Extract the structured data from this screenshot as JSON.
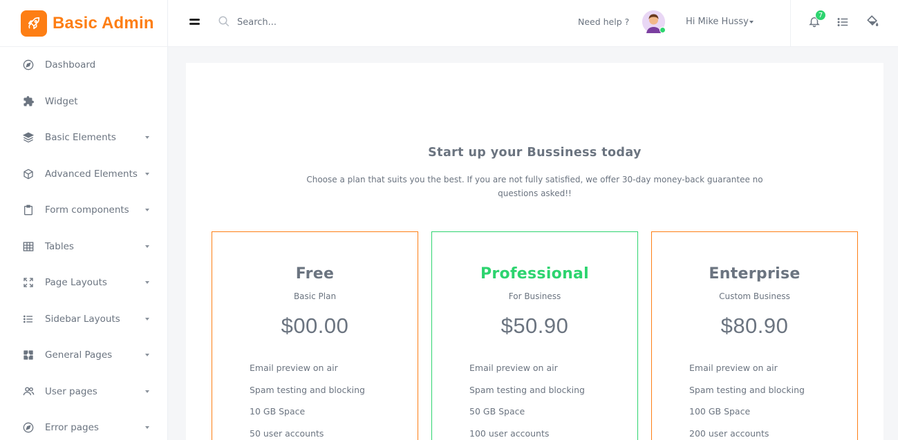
{
  "brand": {
    "name": "Basic Admin",
    "color": "#fd7e14"
  },
  "sidebar": {
    "items": [
      {
        "label": "Dashboard",
        "icon": "compass-icon",
        "has_submenu": false
      },
      {
        "label": "Widget",
        "icon": "puzzle-icon",
        "has_submenu": false
      },
      {
        "label": "Basic Elements",
        "icon": "layers-icon",
        "has_submenu": true
      },
      {
        "label": "Advanced Elements",
        "icon": "box-icon",
        "has_submenu": true
      },
      {
        "label": "Form components",
        "icon": "clipboard-icon",
        "has_submenu": true
      },
      {
        "label": "Tables",
        "icon": "table-icon",
        "has_submenu": true
      },
      {
        "label": "Page Layouts",
        "icon": "expand-icon",
        "has_submenu": true
      },
      {
        "label": "Sidebar Layouts",
        "icon": "list-icon",
        "has_submenu": true
      },
      {
        "label": "General Pages",
        "icon": "grid-icon",
        "has_submenu": true
      },
      {
        "label": "User pages",
        "icon": "users-icon",
        "has_submenu": true
      },
      {
        "label": "Error pages",
        "icon": "compass-icon",
        "has_submenu": true
      }
    ]
  },
  "header": {
    "search_placeholder": "Search...",
    "help_label": "Need help ?",
    "user_greeting": "Hi Mike Hussy",
    "notification_count": "7"
  },
  "main": {
    "title": "Start up your Bussiness today",
    "subtitle": "Choose a plan that suits you the best. If you are not fully satisfied, we offer 30-day money-back guarantee no questions asked!!",
    "plans": [
      {
        "name": "Free",
        "sub": "Basic Plan",
        "price": "$00.00",
        "features": [
          "Email preview on air",
          "Spam testing and blocking",
          "10 GB Space",
          "50 user accounts"
        ]
      },
      {
        "name": "Professional",
        "sub": "For Business",
        "price": "$50.90",
        "features": [
          "Email preview on air",
          "Spam testing and blocking",
          "50 GB Space",
          "100 user accounts"
        ]
      },
      {
        "name": "Enterprise",
        "sub": "Custom Business",
        "price": "$80.90",
        "features": [
          "Email preview on air",
          "Spam testing and blocking",
          "100 GB Space",
          "200 user accounts"
        ]
      }
    ]
  },
  "colors": {
    "accent": "#fd7e14",
    "success": "#2dd46f",
    "text": "#6b7480"
  }
}
